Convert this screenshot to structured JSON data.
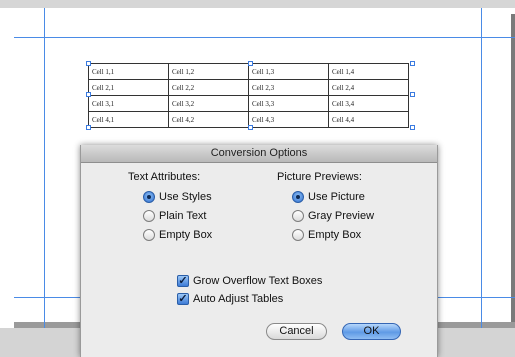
{
  "table": {
    "rows": [
      [
        "Cell 1,1",
        "Cell 1,2",
        "Cell 1,3",
        "Cell 1,4"
      ],
      [
        "Cell 2,1",
        "Cell 2,2",
        "Cell 2,3",
        "Cell 2,4"
      ],
      [
        "Cell 3,1",
        "Cell 3,2",
        "Cell 3,3",
        "Cell 3,4"
      ],
      [
        "Cell 4,1",
        "Cell 4,2",
        "Cell 4,3",
        "Cell 4,4"
      ]
    ]
  },
  "dialog": {
    "title": "Conversion Options",
    "text_attributes": {
      "label": "Text Attributes:",
      "options": [
        "Use Styles",
        "Plain Text",
        "Empty Box"
      ],
      "selected": "Use Styles"
    },
    "picture_previews": {
      "label": "Picture Previews:",
      "options": [
        "Use Picture",
        "Gray Preview",
        "Empty Box"
      ],
      "selected": "Use Picture"
    },
    "checkboxes": [
      {
        "label": "Grow Overflow Text Boxes",
        "checked": true
      },
      {
        "label": "Auto Adjust Tables",
        "checked": true
      }
    ],
    "cancel_label": "Cancel",
    "ok_label": "OK"
  },
  "colors": {
    "guide": "#4a8be6",
    "default_button": "#5f9ae6"
  }
}
